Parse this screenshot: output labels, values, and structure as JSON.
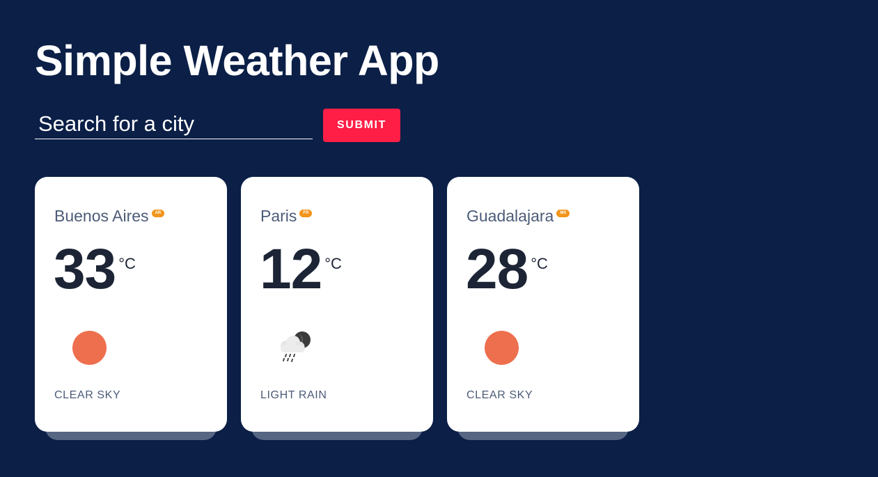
{
  "app": {
    "title": "Simple Weather App"
  },
  "search": {
    "placeholder": "Search for a city",
    "value": "",
    "submit_label": "SUBMIT"
  },
  "cards": [
    {
      "city": "Buenos Aires",
      "country": "AR",
      "temperature": "33",
      "unit": "°C",
      "icon": "clear-sky-sun-icon",
      "description": "CLEAR SKY"
    },
    {
      "city": "Paris",
      "country": "FR",
      "temperature": "12",
      "unit": "°C",
      "icon": "light-rain-cloud-icon",
      "description": "LIGHT RAIN"
    },
    {
      "city": "Guadalajara",
      "country": "MX",
      "temperature": "28",
      "unit": "°C",
      "icon": "clear-sky-sun-icon",
      "description": "CLEAR SKY"
    }
  ],
  "colors": {
    "background": "#0b1f47",
    "submit": "#ff1e46",
    "badge": "#f2951b",
    "sun": "#ee6f4e",
    "card": "#ffffff"
  }
}
